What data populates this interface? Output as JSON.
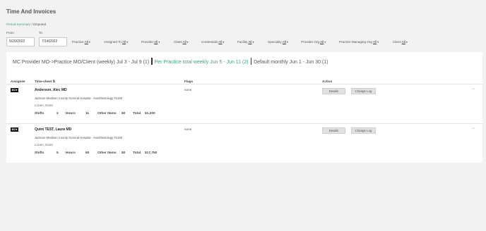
{
  "header": {
    "title": "Time And Invoices",
    "breadcrumb": {
      "link": "Period Summary",
      "separator": " / ",
      "current": "Disputed"
    }
  },
  "dates": {
    "from_label": "From",
    "from_value": "5/20/2022",
    "to_label": "To",
    "to_value": "7/14/2022"
  },
  "filters": [
    {
      "label": "Practice",
      "value": "All"
    },
    {
      "label": "Assigned To",
      "value": "All"
    },
    {
      "label": "Provider",
      "value": "All"
    },
    {
      "label": "Class",
      "value": "All"
    },
    {
      "label": "Credentials",
      "value": "All"
    },
    {
      "label": "Facility",
      "value": "All"
    },
    {
      "label": "Speciality",
      "value": "All"
    },
    {
      "label": "Provider Org",
      "value": "All"
    },
    {
      "label": "Practice Managing Org",
      "value": "All"
    },
    {
      "label": "Client",
      "value": "All"
    }
  ],
  "tabs": [
    {
      "label": "MC Provider MO->Practice MO/Client (weekly) Jul 3 - Jul 9 (1)",
      "active": false
    },
    {
      "label": "Per Practice total weekly Jun 5 - Jun 11 (2)",
      "active": true
    },
    {
      "label": "Default monthly Jun 1 - Jun 30 (1)",
      "active": false
    }
  ],
  "table": {
    "headers": {
      "assignee": "Assignee",
      "timesheet": "Time-sheet",
      "sort_icon": "⇅",
      "flags": "Flags",
      "action": "Action"
    },
    "rows": [
      {
        "badge": "BC▾",
        "name": "Anderson, Alec MD",
        "facility": "Jackson-Madison County General Hospital - Anesthesiology #2189",
        "role": "Locum, Scout",
        "shifts_label": "Shifts",
        "shifts": "2",
        "hours_label": "Hours",
        "hours": "11",
        "other_label": "Other Items",
        "other": "$0",
        "total_label": "Total",
        "total": "$1,200",
        "flags": "none",
        "details_label": "Details",
        "changelog_label": "Change Log",
        "more": "···"
      },
      {
        "badge": "BC▾",
        "name": "Quint TEST, Laura MD",
        "facility": "Jackson-Madison County General Hospital - Anesthesiology #2189",
        "role": "Locum, Scout",
        "shifts_label": "Shifts",
        "shifts": "5",
        "hours_label": "Hours",
        "hours": "60",
        "other_label": "Other Items",
        "other": "$0",
        "total_label": "Total",
        "total": "$17,750",
        "flags": "none",
        "details_label": "Details",
        "changelog_label": "Change Log",
        "more": "···"
      }
    ]
  },
  "colors": {
    "accent": "#3aa67a",
    "background": "#f2f2f2",
    "panel": "#ffffff",
    "button": "#e1e1e1"
  }
}
